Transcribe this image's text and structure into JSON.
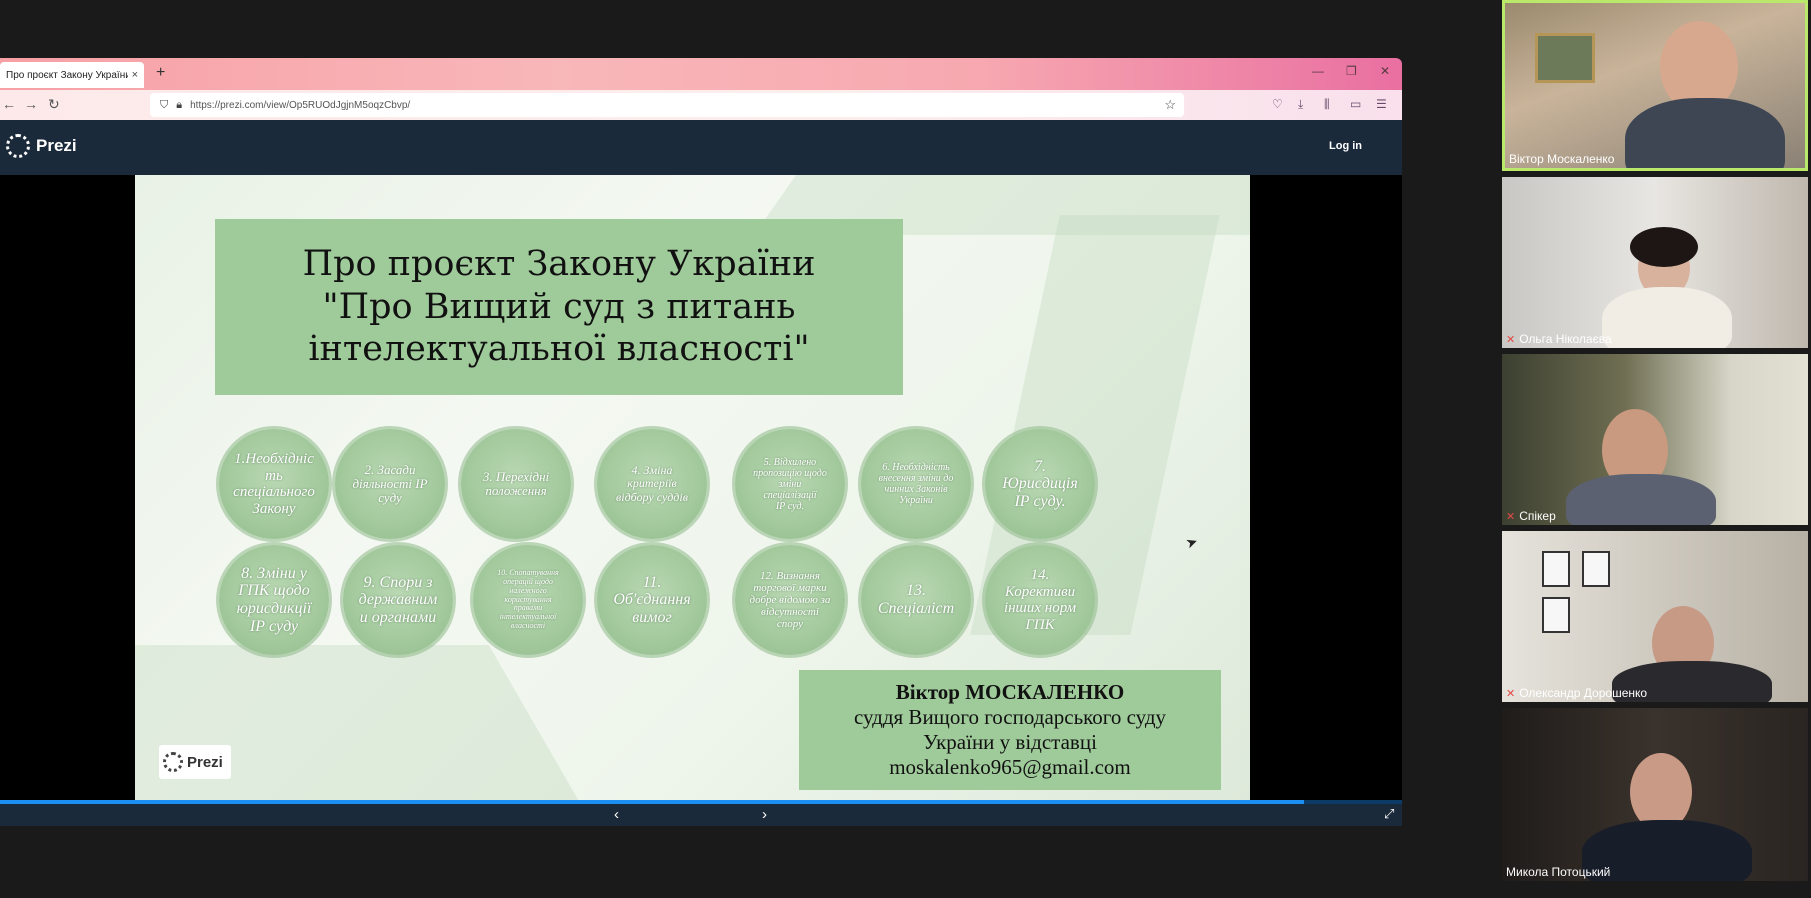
{
  "browser": {
    "tab_title": "Про проєкт Закону України \"П",
    "tab_close": "×",
    "new_tab": "+",
    "url": "https://prezi.com/view/Op5RUOdJgjnM5oqzCbvp/",
    "win_min": "—",
    "win_restore": "❐",
    "win_close": "✕"
  },
  "prezi": {
    "logo_text": "Prezi",
    "login": "Log in"
  },
  "slide": {
    "title": "Про проєкт Закону України\n\"Про Вищий суд з питань\nінтелектуальної власності\"",
    "circles": [
      "1.Необхідніс\nть\nспеціального\nЗакону",
      "2. Засади\nдіяльності ІР\nсуду",
      "3. Перехідні\nположення",
      "4. Зміна\nкритеріїв\nвідбору суддів",
      "5. Відхилено\nпропозицію щодо\nзміни\nспеціалізації\nІР суд.",
      "6. Необхідність\nвнесення зміни до\nчинних Законів\nУкраїни",
      "7.\nЮрисдиція\nІР суду.",
      "8. Зміни у\nГПК щодо\nюрисдикції\nІР суду",
      "9. Спори з\nдержавним\nи органами",
      "10. Спопатування\nоперацій щодо\nналежного\nкористування\nправами\nінтелектуальної\nвласності",
      "11.\nОб'єднання\nвимог",
      "12. Визнання\nторгової марки\nдобре відомою за\nвідсутності\nспору",
      "13.\nСпеціаліст",
      "14.\nКорективи\nінших норм\nГПК"
    ],
    "author_name": "Віктор МОСКАЛЕНКО",
    "author_line1": "суддя Вищого господарського суду",
    "author_line2": "України у відставці",
    "author_email": "moskalenko965@gmail.com",
    "logo_text": "Prezi"
  },
  "controls": {
    "prev": "‹",
    "next": "›",
    "fullscreen": "⤢",
    "progress": 0.93
  },
  "participants": [
    {
      "name": "Віктор Москаленко",
      "muted": false,
      "active": true
    },
    {
      "name": "Ольга Ніколаєва",
      "muted": true,
      "active": false
    },
    {
      "name": "Спікер",
      "muted": true,
      "active": false
    },
    {
      "name": "Олександр Дорошенко",
      "muted": true,
      "active": false
    },
    {
      "name": "Микола Потоцький",
      "muted": false,
      "active": false
    }
  ],
  "colors": {
    "slide_green": "#9fca9a",
    "prezi_navy": "#1b2a3a",
    "progress_blue": "#1b8ef2",
    "active_speaker": "#b9e86a"
  }
}
